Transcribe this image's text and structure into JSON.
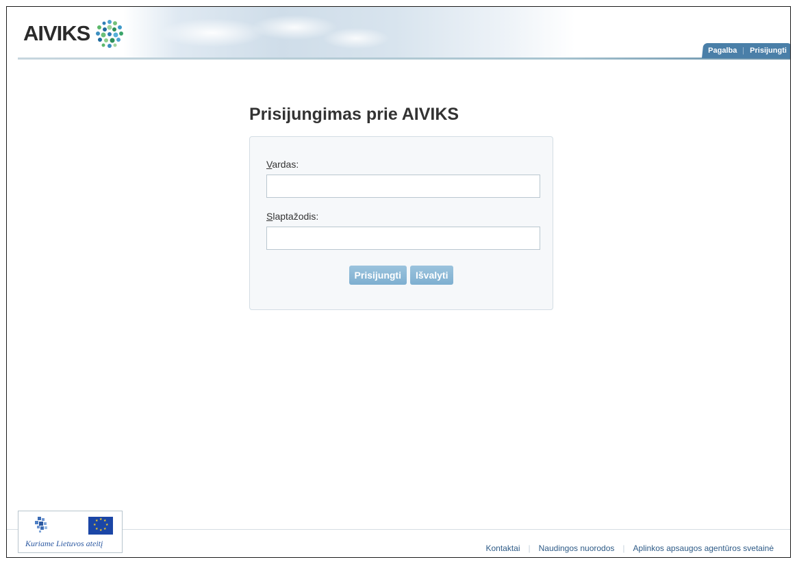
{
  "header": {
    "logo_text": "AIVIKS",
    "nav": [
      "Pagalba",
      "Prisijungti"
    ]
  },
  "login": {
    "title": "Prisijungimas prie AIVIKS",
    "username_label_first": "V",
    "username_label_rest": "ardas:",
    "username_value": "",
    "password_label_first": "S",
    "password_label_rest": "laptažodis:",
    "password_value": "",
    "submit_label": "Prisijungti",
    "clear_label": "Išvalyti"
  },
  "footer": {
    "slogan": "Kuriame Lietuvos ateitį",
    "links": [
      "Kontaktai",
      "Naudingos nuorodos",
      "Aplinkos apsaugos agentūros svetainė"
    ]
  },
  "colors": {
    "accent": "#4a7fa8",
    "button": "#8ab8d7",
    "link": "#2d5a86"
  }
}
